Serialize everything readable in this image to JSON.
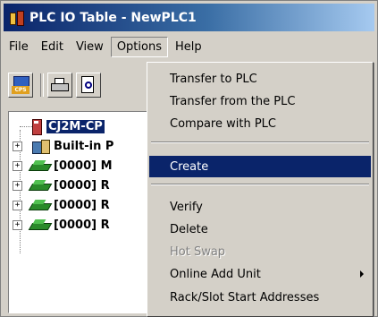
{
  "window": {
    "title": "PLC IO Table - NewPLC1"
  },
  "menubar": {
    "items": [
      "File",
      "Edit",
      "View",
      "Options",
      "Help"
    ]
  },
  "toolbar": {
    "buttons": [
      "cps-file-icon",
      "print-icon",
      "print-preview-icon"
    ]
  },
  "tree": {
    "items": [
      {
        "label": "CJ2M-CP",
        "icon": "plc-cpu-icon",
        "selected": true
      },
      {
        "label": "Built-in P",
        "icon": "builtin-io-icon"
      },
      {
        "label": "[0000] M",
        "icon": "unit-icon"
      },
      {
        "label": "[0000] R",
        "icon": "unit-icon"
      },
      {
        "label": "[0000] R",
        "icon": "unit-icon"
      },
      {
        "label": "[0000] R",
        "icon": "unit-icon"
      }
    ]
  },
  "options_menu": {
    "items": [
      {
        "label": "Transfer to PLC"
      },
      {
        "label": "Transfer from the PLC"
      },
      {
        "label": "Compare with PLC"
      },
      {
        "label": "Create",
        "highlighted": true
      },
      {
        "label": "Verify"
      },
      {
        "label": "Delete"
      },
      {
        "label": "Hot Swap",
        "disabled": true
      },
      {
        "label": "Online Add Unit",
        "submenu": true
      },
      {
        "label": "Rack/Slot Start Addresses"
      }
    ]
  },
  "colors": {
    "titlebar_start": "#0a246a",
    "titlebar_end": "#a6caf0",
    "highlight": "#0a246a",
    "face": "#d4d0c8"
  }
}
